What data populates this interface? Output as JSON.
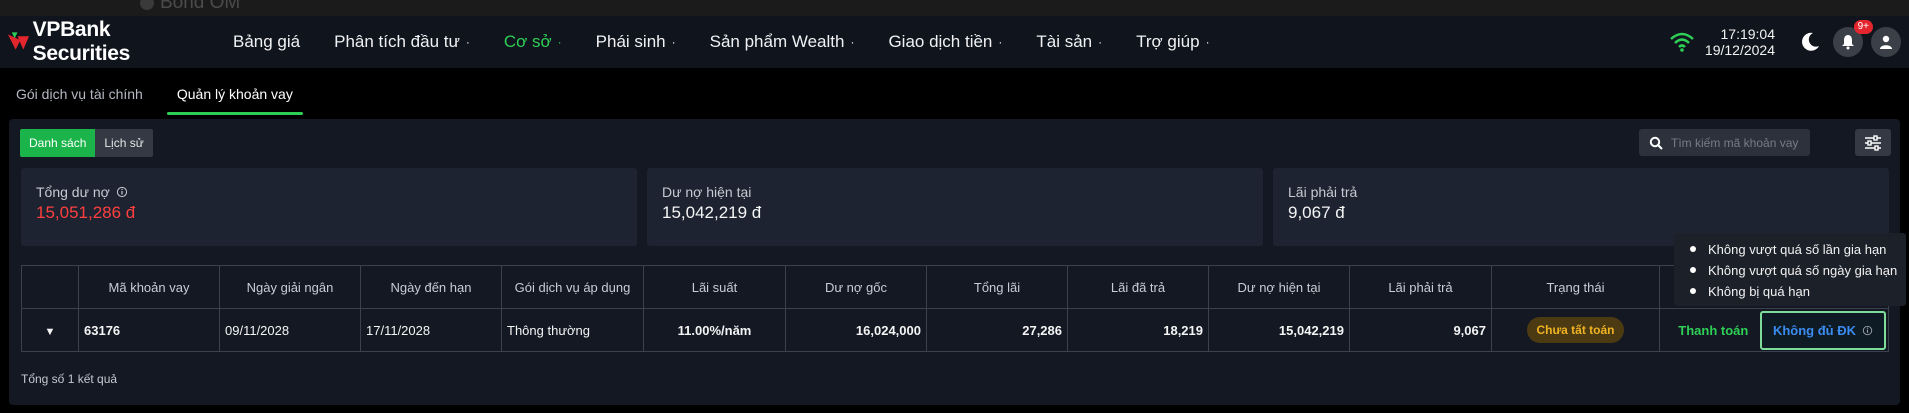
{
  "ghost_strip": {
    "text": "Bond OM"
  },
  "header": {
    "brand": "VPBank Securities",
    "nav": [
      {
        "label": "Bảng giá",
        "dropdown": false,
        "active": false
      },
      {
        "label": "Phân tích đầu tư",
        "dropdown": true,
        "active": false
      },
      {
        "label": "Cơ sở",
        "dropdown": true,
        "active": true
      },
      {
        "label": "Phái sinh",
        "dropdown": true,
        "active": false
      },
      {
        "label": "Sản phẩm Wealth",
        "dropdown": true,
        "active": false
      },
      {
        "label": "Giao dịch tiền",
        "dropdown": true,
        "active": false
      },
      {
        "label": "Tài sản",
        "dropdown": true,
        "active": false
      },
      {
        "label": "Trợ giúp",
        "dropdown": true,
        "active": false
      }
    ],
    "dropdown_glyph": "·",
    "time": "17:19:04",
    "date": "19/12/2024",
    "notification_badge": "9+"
  },
  "subtabs": [
    {
      "label": "Gói dịch vụ tài chính",
      "active": false
    },
    {
      "label": "Quản lý khoản vay",
      "active": true
    }
  ],
  "toggle": {
    "list_label": "Danh sách",
    "history_label": "Lịch sử"
  },
  "search": {
    "placeholder": "Tìm kiếm mã khoản vay",
    "value": ""
  },
  "summary": {
    "total_debt_label": "Tổng dư nợ",
    "total_debt_value": "15,051,286 đ",
    "current_debt_label": "Dư nợ hiện tại",
    "current_debt_value": "15,042,219 đ",
    "interest_due_label": "Lãi phải trả",
    "interest_due_value": "9,067 đ"
  },
  "table": {
    "headers": [
      "",
      "Mã khoản vay",
      "Ngày giải ngân",
      "Ngày đến hạn",
      "Gói dịch vụ áp dụng",
      "Lãi suất",
      "Dư nợ gốc",
      "Tổng lãi",
      "Lãi đã trả",
      "Dư nợ hiện tại",
      "Lãi phải trả",
      "Trạng thái",
      ""
    ],
    "rows": [
      {
        "expand": "▼",
        "loan_id": "63176",
        "disbursement_date": "09/11/2028",
        "due_date": "17/11/2028",
        "package": "Thông thường",
        "interest_rate": "11.00%/năm",
        "principal": "16,024,000",
        "total_interest": "27,286",
        "interest_paid": "18,219",
        "current_debt": "15,042,219",
        "interest_due": "9,067",
        "status": "Chưa tất toán",
        "pay_label": "Thanh toán",
        "extend_label": "Không đủ ĐK"
      }
    ]
  },
  "total_results": "Tổng số 1 kết quả",
  "tooltip": {
    "items": [
      "Không vượt quá số lần gia hạn",
      "Không vượt quá số ngày gia hạn",
      "Không bị quá hạn"
    ]
  },
  "colors": {
    "accent_green": "#2ecf56",
    "danger_red": "#ff3f3f",
    "status_amber": "#f0b323",
    "link_blue": "#3b8cf0"
  }
}
